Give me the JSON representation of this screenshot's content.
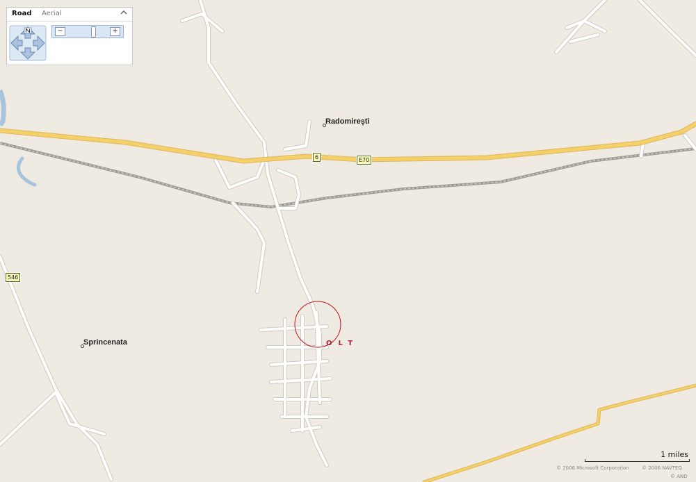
{
  "map_controls": {
    "tabs": [
      {
        "label": "Road",
        "active": true
      },
      {
        "label": "Aerial",
        "active": false
      }
    ],
    "collapse_icon": "chevron-up-icon",
    "compass_icon": "pan-arrows-icon",
    "zoom_out_label": "−",
    "zoom_in_label": "+"
  },
  "places": [
    {
      "name": "Radomireşti"
    },
    {
      "name": "Sprincenata"
    }
  ],
  "road_shields": [
    {
      "label": "6"
    },
    {
      "label": "E70"
    },
    {
      "label": "546"
    }
  ],
  "county_label": "OLT",
  "scale": {
    "label": "1 miles"
  },
  "copyright": [
    "© 2006 Microsoft Corporation",
    "© 2006 NAVTEQ",
    "© AND"
  ],
  "colors": {
    "land": "#efebe2",
    "highway": "#f5d06a",
    "local_road": "#ffffff",
    "railway": "#a9a49c",
    "water": "#a8c4dd",
    "county_label": "#b0213a",
    "search_circle": "#c4121f"
  }
}
